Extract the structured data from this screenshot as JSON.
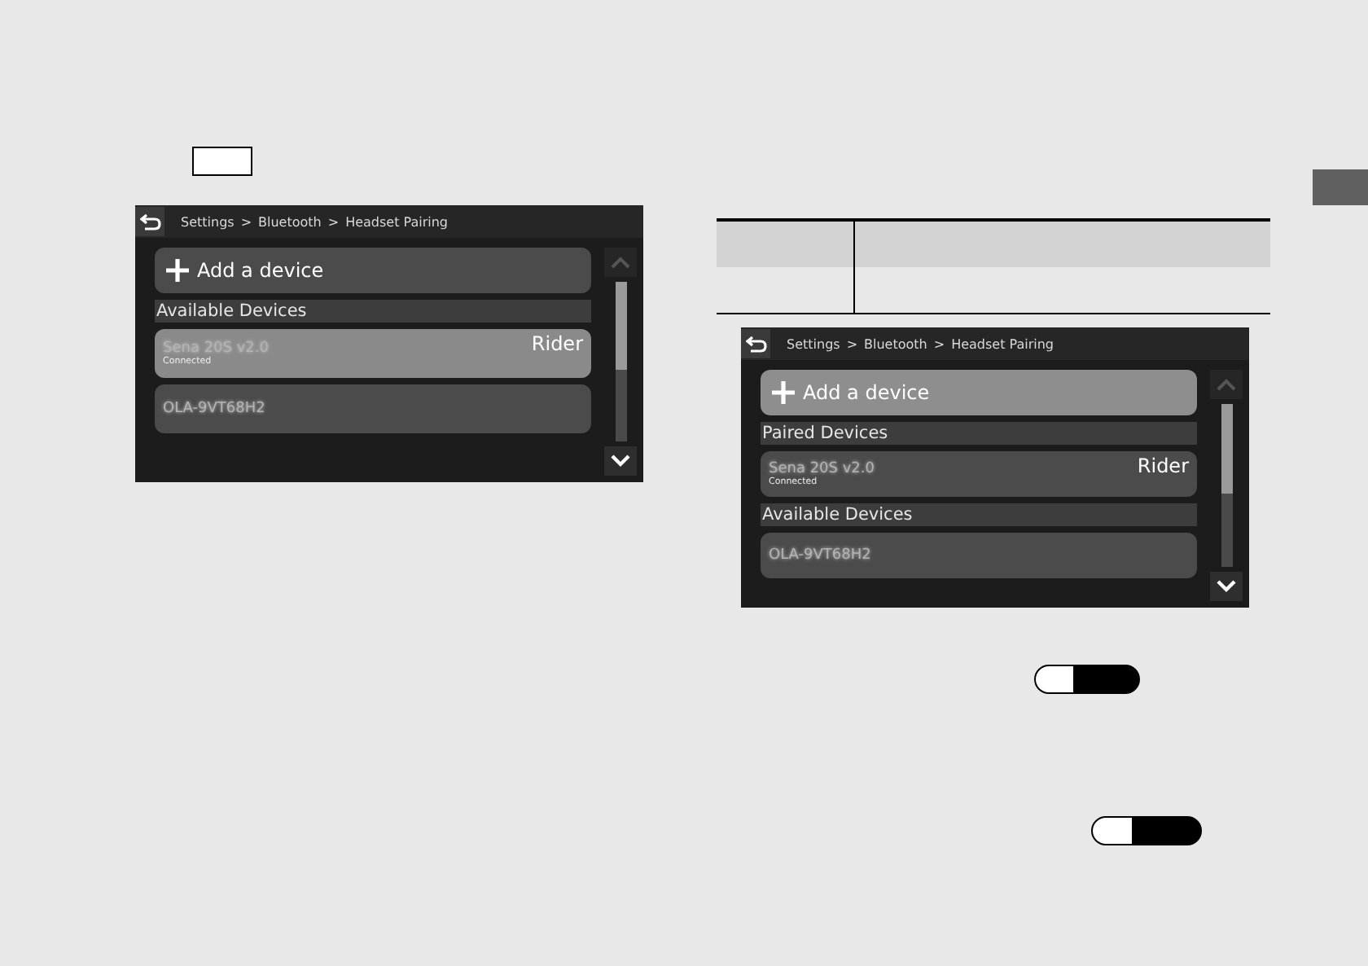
{
  "screens": [
    {
      "breadcrumb": [
        "Settings",
        "Bluetooth",
        "Headset Pairing"
      ],
      "separator": ">",
      "add_button": {
        "label": "Add a device",
        "selected": false
      },
      "sections": [
        {
          "heading": "Available Devices",
          "devices": [
            {
              "name": "Sena 20S v2.0",
              "status": "Connected",
              "role": "Rider",
              "selected": true
            },
            {
              "name": "OLA-9VT68H2",
              "selected": false
            }
          ]
        }
      ]
    },
    {
      "breadcrumb": [
        "Settings",
        "Bluetooth",
        "Headset Pairing"
      ],
      "separator": ">",
      "add_button": {
        "label": "Add a device",
        "selected": true
      },
      "sections": [
        {
          "heading": "Paired Devices",
          "devices": [
            {
              "name": "Sena 20S v2.0",
              "status": "Connected",
              "role": "Rider",
              "selected": false
            }
          ]
        },
        {
          "heading": "Available Devices",
          "devices": [
            {
              "name": "OLA-9VT68H2",
              "selected": false
            }
          ]
        }
      ]
    }
  ]
}
